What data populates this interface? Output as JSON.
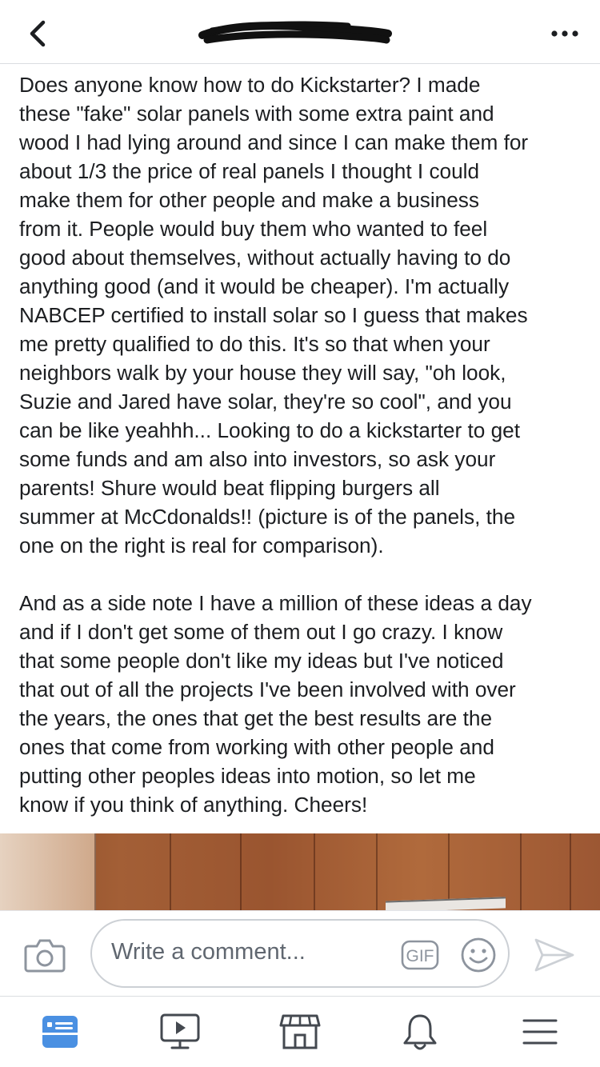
{
  "colors": {
    "text": "#1c1e21",
    "placeholder": "#606770",
    "icon_gray": "#8d949e",
    "accent_blue": "#4a90e2",
    "dark_icon": "#444950"
  },
  "header": {
    "back_icon": "chevron-left-icon",
    "title_redacted": true,
    "more_icon": "more-dots-icon"
  },
  "post": {
    "paragraphs": [
      "Does anyone know how to do Kickstarter? I made\nthese \"fake\" solar panels with some extra paint and\nwood I had lying around and since I can make them for\nabout 1/3 the price of real panels I thought I could\nmake them for other people and make a business\nfrom it. People would buy them who wanted to feel\ngood about themselves, without actually having to do\nanything good (and it would be cheaper). I'm actually\nNABCEP certified to install solar so I guess that makes\nme pretty qualified to do this. It's so that when your\nneighbors walk by your house they will say, \"oh look,\nSuzie and Jared have solar, they're so cool\", and you\ncan be like yeahhh... Looking to do a kickstarter to get\nsome funds and am also into investors, so ask your\nparents!   Shure would beat flipping burgers all\nsummer at McCdonalds!! (picture is of the panels, the\none on the right is real for comparison).",
      "And as a side note I have a million of these ideas a day\nand if I don't get some of them out I go crazy. I know\nthat some people don't like my ideas but I've noticed\nthat out of all the projects I've been involved with over\nthe years, the ones that get the best results are the\nones that come from working with other people and\nputting other peoples ideas into motion, so let me\nknow if you think of anything. Cheers!"
    ]
  },
  "comment": {
    "placeholder": "Write a comment...",
    "gif_label": "GIF",
    "camera_icon": "camera-icon",
    "emoji_icon": "smiley-icon",
    "send_icon": "send-icon"
  },
  "tabs": [
    {
      "name": "news-feed",
      "icon": "news-feed-icon",
      "active": true
    },
    {
      "name": "watch",
      "icon": "video-icon",
      "active": false
    },
    {
      "name": "marketplace",
      "icon": "marketplace-icon",
      "active": false
    },
    {
      "name": "notifications",
      "icon": "bell-icon",
      "active": false
    },
    {
      "name": "menu",
      "icon": "hamburger-menu-icon",
      "active": false
    }
  ]
}
